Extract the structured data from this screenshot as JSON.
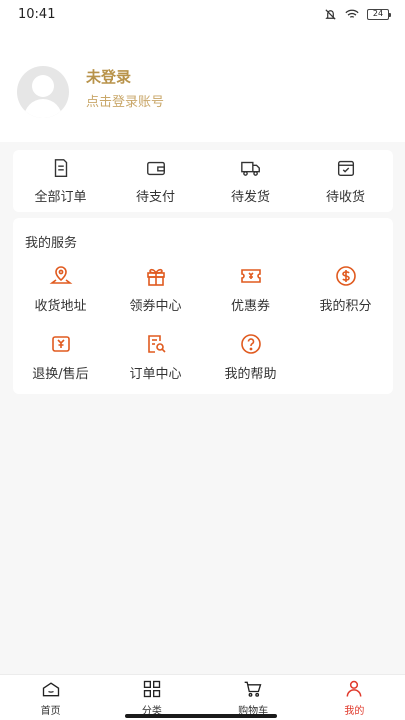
{
  "status_bar": {
    "time": "10:41",
    "battery": "24"
  },
  "profile": {
    "title": "未登录",
    "subtitle": "点击登录账号"
  },
  "orders": [
    {
      "label": "全部订单",
      "icon": "order-list-icon"
    },
    {
      "label": "待支付",
      "icon": "wallet-icon"
    },
    {
      "label": "待发货",
      "icon": "truck-icon"
    },
    {
      "label": "待收货",
      "icon": "package-check-icon"
    }
  ],
  "services": {
    "title": "我的服务",
    "items": [
      {
        "label": "收货地址",
        "icon": "location-icon"
      },
      {
        "label": "领券中心",
        "icon": "gift-icon"
      },
      {
        "label": "优惠券",
        "icon": "coupon-icon"
      },
      {
        "label": "我的积分",
        "icon": "points-icon"
      },
      {
        "label": "退换/售后",
        "icon": "refund-icon"
      },
      {
        "label": "订单中心",
        "icon": "order-search-icon"
      },
      {
        "label": "我的帮助",
        "icon": "help-icon"
      }
    ]
  },
  "tabs": [
    {
      "label": "首页",
      "icon": "home-icon"
    },
    {
      "label": "分类",
      "icon": "category-icon"
    },
    {
      "label": "购物车",
      "icon": "cart-icon"
    },
    {
      "label": "我的",
      "icon": "profile-icon",
      "active": true
    }
  ],
  "colors": {
    "gold": "#b8934a",
    "accent": "#e05a1f",
    "active_tab": "#e0392b"
  }
}
